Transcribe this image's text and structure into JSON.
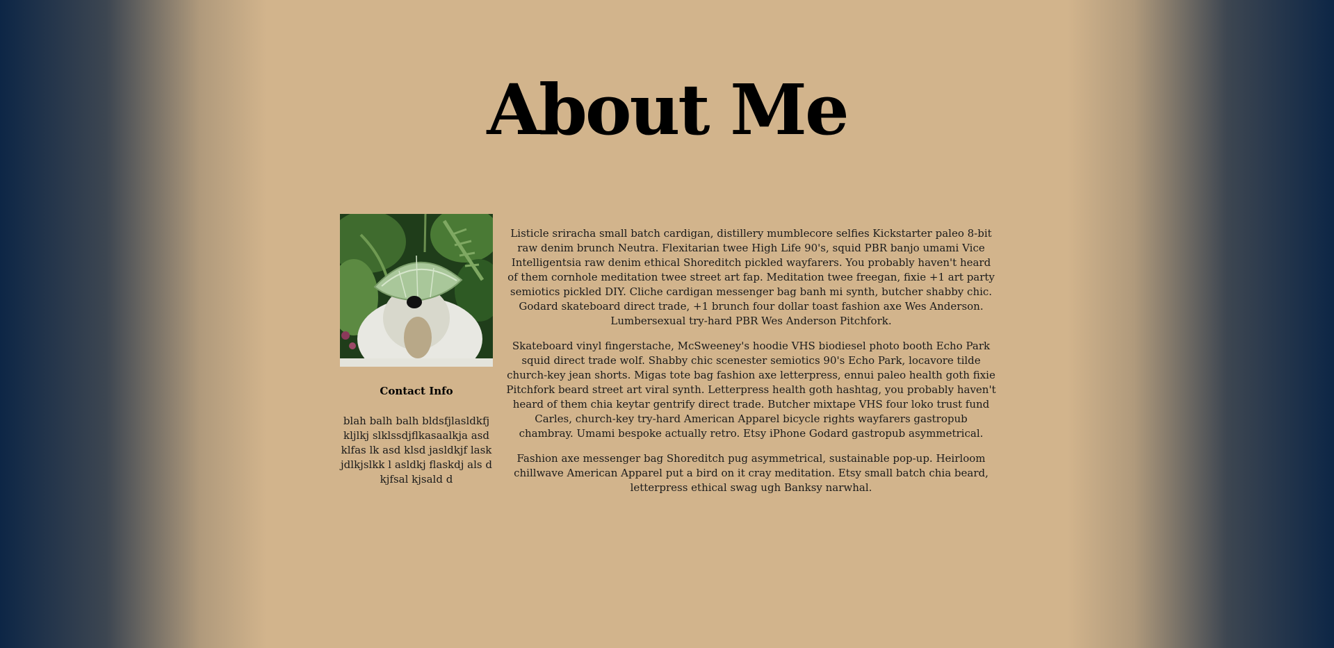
{
  "page": {
    "title": "About Me"
  },
  "sidebar": {
    "photo_alt": "sheepdog wearing a leaf hat",
    "contact_heading": "Contact Info",
    "contact_body": "blah balh balh bldsfjlasldkfjkljlkj slklssdjflkasaalkja asdklfas lk asd klsd jasldkjf laskjdlkjslkk l asldkj flaskdj als dkjfsal kjsald d"
  },
  "main": {
    "paragraphs": [
      "Listicle sriracha small batch cardigan, distillery mumblecore selfies Kickstarter paleo 8-bit raw denim brunch Neutra. Flexitarian twee High Life 90's, squid PBR banjo umami Vice Intelligentsia raw denim ethical Shoreditch pickled wayfarers. You probably haven't heard of them cornhole meditation twee street art fap. Meditation twee freegan, fixie +1 art party semiotics pickled DIY. Cliche cardigan messenger bag banh mi synth, butcher shabby chic. Godard skateboard direct trade, +1 brunch four dollar toast fashion axe Wes Anderson. Lumbersexual try-hard PBR Wes Anderson Pitchfork.",
      "Skateboard vinyl fingerstache, McSweeney's hoodie VHS biodiesel photo booth Echo Park squid direct trade wolf. Shabby chic scenester semiotics 90's Echo Park, locavore tilde church-key jean shorts. Migas tote bag fashion axe letterpress, ennui paleo health goth fixie Pitchfork beard street art viral synth. Letterpress health goth hashtag, you probably haven't heard of them chia keytar gentrify direct trade. Butcher mixtape VHS four loko trust fund Carles, church-key try-hard American Apparel bicycle rights wayfarers gastropub chambray. Umami bespoke actually retro. Etsy iPhone Godard gastropub asymmetrical.",
      "Fashion axe messenger bag Shoreditch pug asymmetrical, sustainable pop-up. Heirloom chillwave American Apparel put a bird on it cray meditation. Etsy small batch chia beard, letterpress ethical swag ugh Banksy narwhal."
    ]
  },
  "colors": {
    "background_center": "#d2b48c",
    "background_edge": "#0d2646",
    "text": "#1a1a1a",
    "title": "#000000"
  }
}
